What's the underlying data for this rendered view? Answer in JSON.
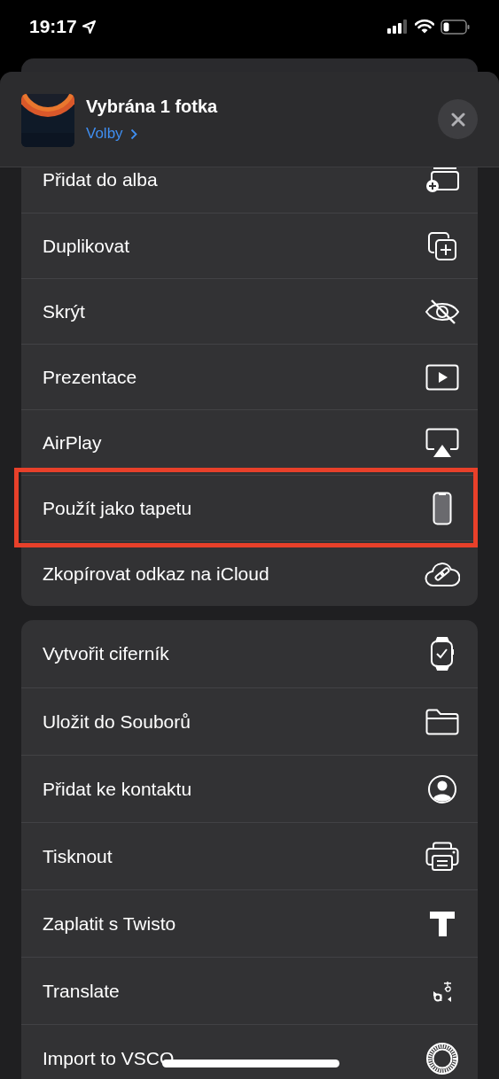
{
  "status_bar": {
    "time": "19:17"
  },
  "header": {
    "title": "Vybrána 1 fotka",
    "options_link": "Volby"
  },
  "groups": [
    {
      "items": [
        {
          "label": "Přidat do alba",
          "highlighted": false
        },
        {
          "label": "Duplikovat",
          "highlighted": false
        },
        {
          "label": "Skrýt",
          "highlighted": false
        },
        {
          "label": "Prezentace",
          "highlighted": false
        },
        {
          "label": "AirPlay",
          "highlighted": false
        },
        {
          "label": "Použít jako tapetu",
          "highlighted": true
        },
        {
          "label": "Zkopírovat odkaz na iCloud",
          "highlighted": false
        }
      ]
    },
    {
      "items": [
        {
          "label": "Vytvořit ciferník",
          "highlighted": false
        },
        {
          "label": "Uložit do Souborů",
          "highlighted": false
        },
        {
          "label": "Přidat ke kontaktu",
          "highlighted": false
        },
        {
          "label": "Tisknout",
          "highlighted": false
        },
        {
          "label": "Zaplatit s Twisto",
          "highlighted": false
        },
        {
          "label": "Translate",
          "highlighted": false
        },
        {
          "label": "Import to VSCO",
          "highlighted": false
        }
      ]
    }
  ]
}
